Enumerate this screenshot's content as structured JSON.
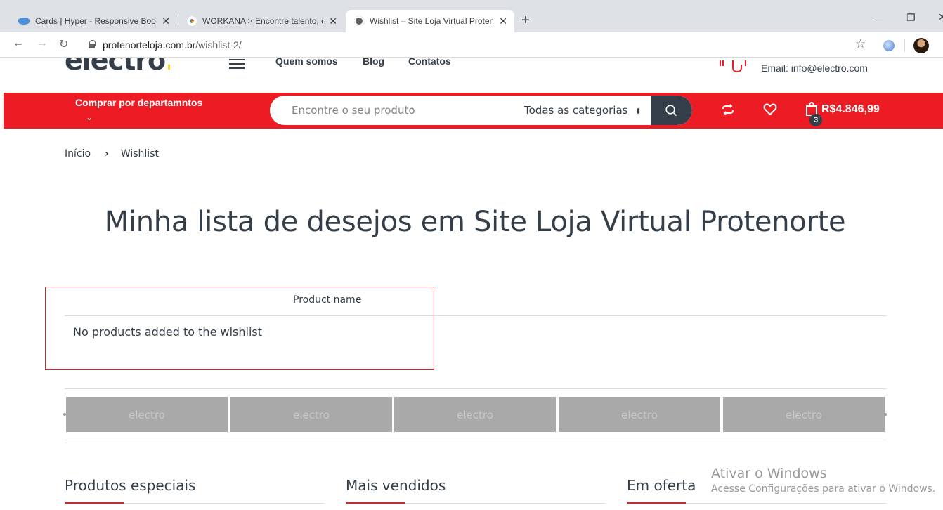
{
  "browser": {
    "tabs": [
      {
        "title": "Cards | Hyper - Responsive Bootstrap",
        "favicon": "hyper-icon",
        "active": false
      },
      {
        "title": "WORKANA > Encontre talento, e",
        "favicon": "workana-icon",
        "active": false
      },
      {
        "title": "Wishlist – Site Loja Virtual Protenorte",
        "favicon": "globe-icon",
        "active": true
      }
    ],
    "url_host": "protenorteloja.com.br",
    "url_path": "/wishlist-2/"
  },
  "header": {
    "logo_text": "electro",
    "logo_dot": ".",
    "nav": [
      "Quem somos",
      "Blog",
      "Contatos"
    ],
    "email": "Email: info@electro.com"
  },
  "bar": {
    "departments_label": "Comprar por departamntos",
    "search_placeholder": "Encontre o seu produto",
    "category_selected": "Todas as categorias",
    "cart_count": "3",
    "cart_total": "R$4.846,99",
    "accent_color": "#ed1c24",
    "dark_color": "#333e48"
  },
  "breadcrumb": {
    "home": "Início",
    "separator": "›",
    "current": "Wishlist"
  },
  "page": {
    "title": "Minha lista de desejos em Site Loja Virtual Protenorte"
  },
  "wishlist": {
    "column_header": "Product name",
    "empty_message": "No products added to the wishlist"
  },
  "brands": [
    "electro",
    "electro",
    "electro",
    "electro",
    "electro"
  ],
  "footer_widgets": {
    "special": "Produtos especiais",
    "best_sellers": "Mais vendidos",
    "on_sale": "Em oferta"
  },
  "windows_watermark": {
    "title": "Ativar o Windows",
    "subtitle": "Acesse Configurações para ativar o Windows."
  }
}
